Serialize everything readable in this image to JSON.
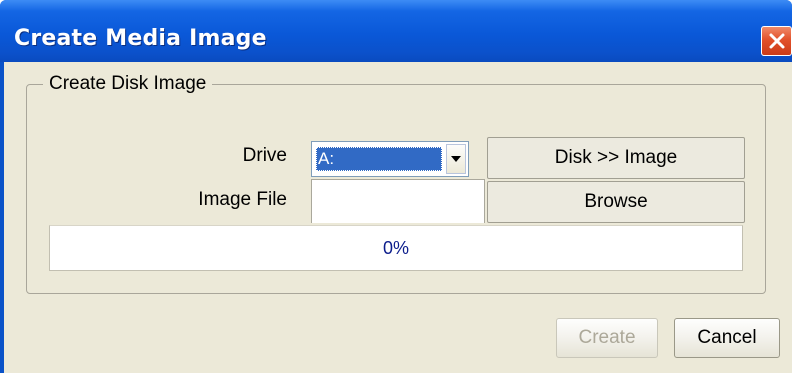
{
  "window": {
    "title": "Create Media Image"
  },
  "group": {
    "title": "Create Disk Image"
  },
  "drive": {
    "label": "Drive",
    "selected": "A:"
  },
  "image_file": {
    "label": "Image File",
    "value": ""
  },
  "buttons": {
    "disk_to_image": "Disk >> Image",
    "browse": "Browse",
    "create": "Create",
    "cancel": "Cancel"
  },
  "progress": {
    "percent": 0,
    "text": "0%"
  },
  "icons": {
    "close": "close-icon",
    "dropdown": "chevron-down-icon"
  },
  "colors": {
    "titlebar": "#0a58d8",
    "close_button": "#e2512b",
    "dialog_bg": "#ece9d8",
    "selection": "#316ac5",
    "progress_text": "#0c1d8c"
  }
}
